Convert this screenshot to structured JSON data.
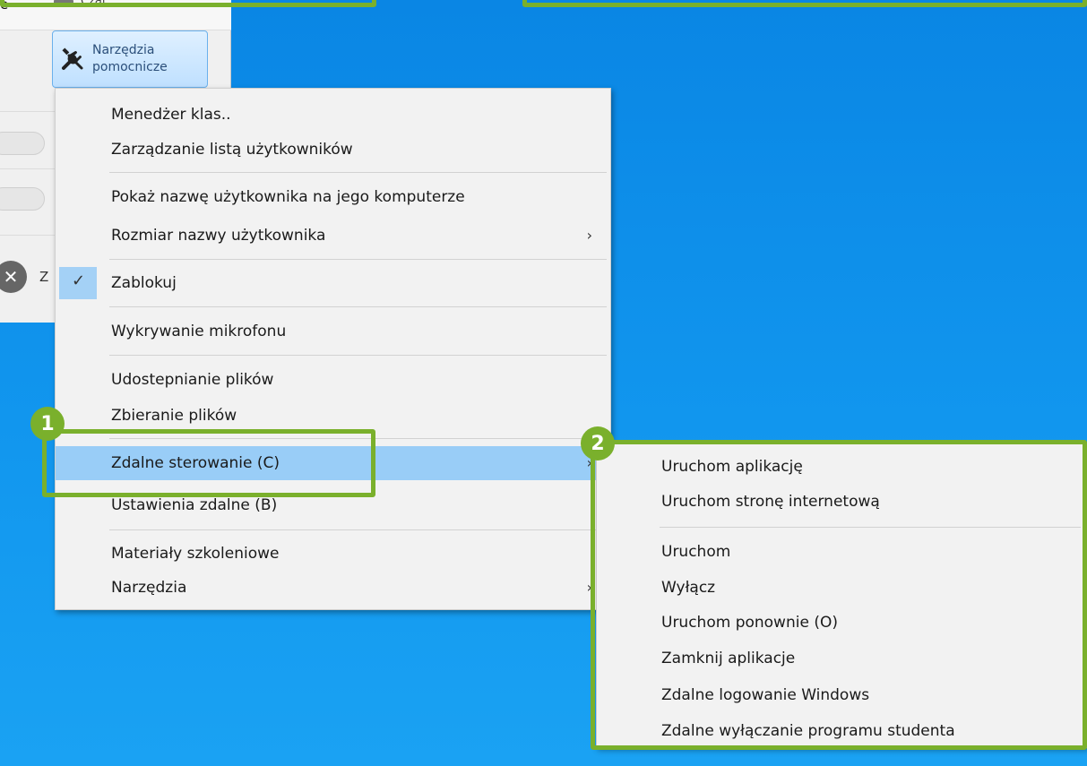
{
  "app": {
    "cut_left_text": "e",
    "chat_label": "Czat",
    "tools_button_label": "Narzędzia\npomocnicze",
    "close_letter": "Z"
  },
  "menu": {
    "items": [
      {
        "label": "Menedżer klas.."
      },
      {
        "label": "Zarządzanie listą użytkowników"
      },
      {
        "label": "Pokaż nazwę użytkownika na jego komputerze"
      },
      {
        "label": "Rozmiar nazwy użytkownika",
        "has_submenu": true
      },
      {
        "label": "Zablokuj",
        "checked": true
      },
      {
        "label": "Wykrywanie mikrofonu"
      },
      {
        "label": "Udostepnianie plików"
      },
      {
        "label": "Zbieranie plików"
      },
      {
        "label": "Zdalne sterowanie (C)",
        "highlighted": true,
        "has_submenu": true
      },
      {
        "label": "Ustawienia zdalne (B)"
      },
      {
        "label": "Materiały szkoleniowe"
      },
      {
        "label": "Narzędzia",
        "has_submenu": true
      }
    ],
    "arrow_glyph": "›",
    "check_glyph": "✓"
  },
  "submenu": {
    "items": [
      {
        "label": "Uruchom aplikację"
      },
      {
        "label": "Uruchom stronę internetową"
      },
      {
        "label": "Uruchom"
      },
      {
        "label": "Wyłącz"
      },
      {
        "label": "Uruchom ponownie (O)"
      },
      {
        "label": "Zamknij aplikacje"
      },
      {
        "label": "Zdalne logowanie Windows"
      },
      {
        "label": "Zdalne wyłączanie programu studenta"
      }
    ]
  },
  "callouts": {
    "badge_1": "1",
    "badge_2": "2",
    "accent_color": "#7ab02c"
  },
  "colors": {
    "desktop": "#0a86e4",
    "highlight": "#99cdf7"
  }
}
